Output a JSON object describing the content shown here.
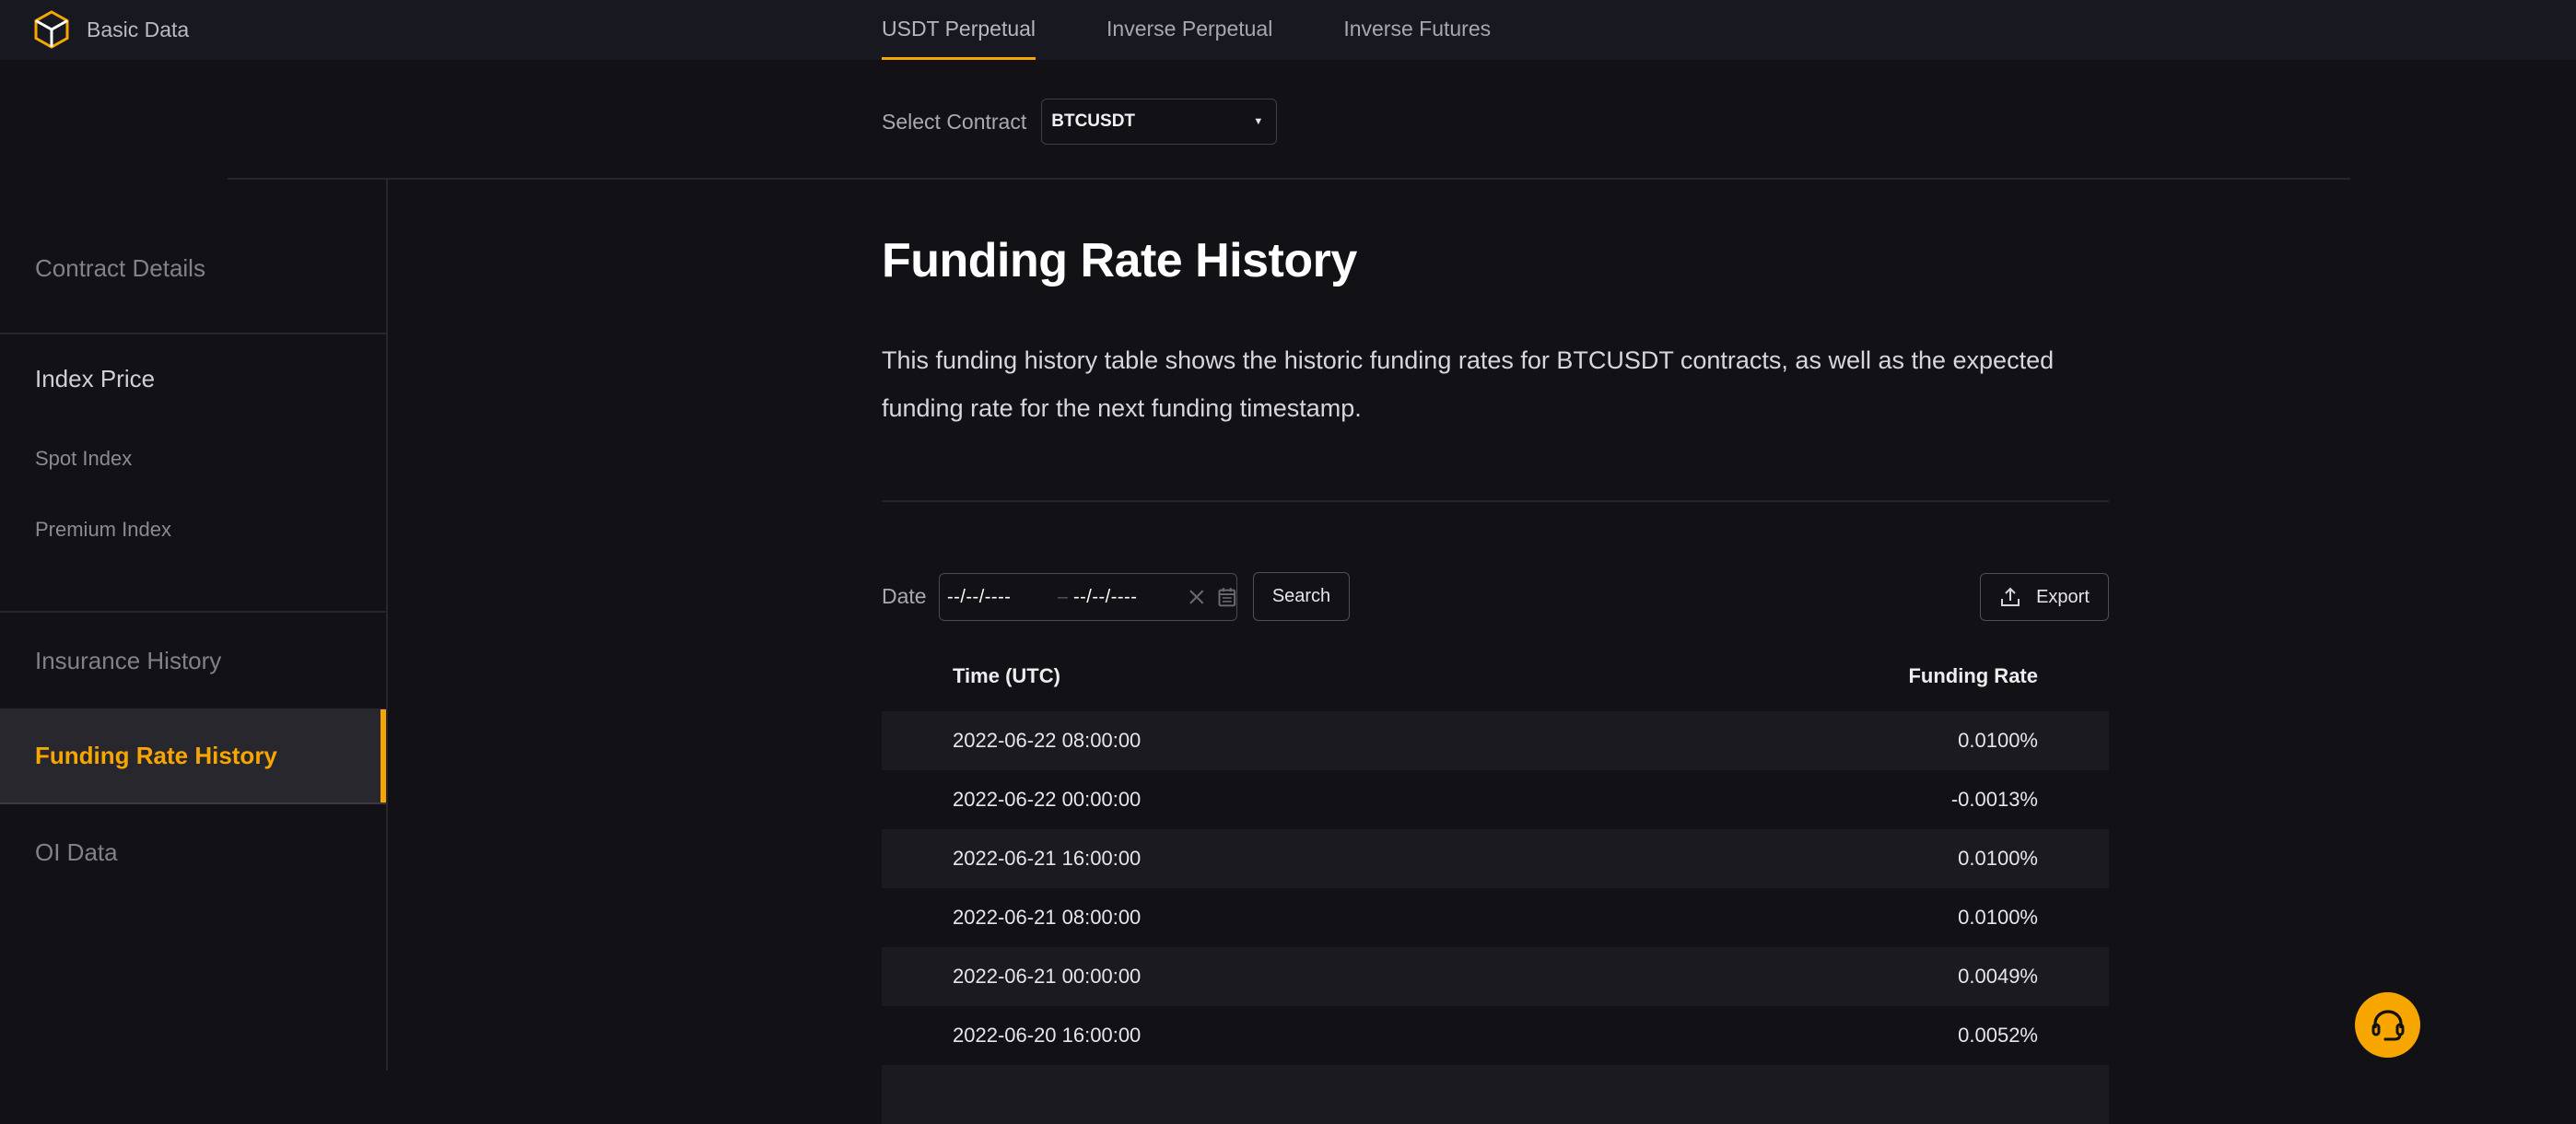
{
  "header": {
    "brand_label": "Basic Data",
    "tabs": [
      {
        "label": "USDT Perpetual",
        "active": true
      },
      {
        "label": "Inverse Perpetual",
        "active": false
      },
      {
        "label": "Inverse Futures",
        "active": false
      }
    ]
  },
  "contract": {
    "label": "Select Contract",
    "selected": "BTCUSDT"
  },
  "sidebar": {
    "items": [
      {
        "label": "Contract Details"
      },
      {
        "label": "Index Price"
      },
      {
        "label": "Spot Index"
      },
      {
        "label": "Premium Index"
      },
      {
        "label": "Insurance History"
      },
      {
        "label": "Funding Rate History",
        "active": true
      },
      {
        "label": "OI Data"
      }
    ]
  },
  "main": {
    "title": "Funding Rate History",
    "description": "This funding history table shows the historic funding rates for BTCUSDT contracts, as well as the expected funding rate for the next funding timestamp.",
    "filter": {
      "date_label": "Date",
      "start_placeholder": "--/--/----",
      "separator": "–",
      "end_placeholder": "--/--/----",
      "search_label": "Search",
      "export_label": "Export"
    },
    "table": {
      "columns": [
        "Time (UTC)",
        "Funding Rate"
      ],
      "rows": [
        [
          "2022-06-22 08:00:00",
          "0.0100%"
        ],
        [
          "2022-06-22 00:00:00",
          "-0.0013%"
        ],
        [
          "2022-06-21 16:00:00",
          "0.0100%"
        ],
        [
          "2022-06-21 08:00:00",
          "0.0100%"
        ],
        [
          "2022-06-21 00:00:00",
          "0.0049%"
        ],
        [
          "2022-06-20 16:00:00",
          "0.0052%"
        ],
        [
          "",
          ""
        ]
      ]
    }
  },
  "colors": {
    "accent": "#F7A600",
    "background": "#111116",
    "topbar": "#181920"
  },
  "support": {
    "icon": "headset-icon"
  }
}
